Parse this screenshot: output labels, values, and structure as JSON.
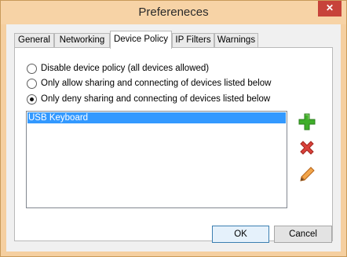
{
  "window": {
    "title": "Prefereneces",
    "close_label": "✕"
  },
  "tabs": [
    {
      "label": "General"
    },
    {
      "label": "Networking"
    },
    {
      "label": "Device Policy"
    },
    {
      "label": "IP Filters"
    },
    {
      "label": "Warnings"
    }
  ],
  "device_policy": {
    "options": [
      {
        "label": "Disable device policy (all devices allowed)",
        "selected": false
      },
      {
        "label": "Only allow sharing and connecting of devices listed below",
        "selected": false
      },
      {
        "label": "Only deny sharing and connecting of devices listed below",
        "selected": true
      }
    ],
    "devices": [
      {
        "name": "USB Keyboard",
        "selected": true
      }
    ],
    "actions": [
      "add-icon",
      "remove-icon",
      "edit-icon"
    ]
  },
  "footer": {
    "ok_label": "OK",
    "cancel_label": "Cancel"
  },
  "colors": {
    "accent": "#3399ff",
    "frame": "#f5cfa0",
    "close": "#c7433a",
    "add_green": "#3fae2a",
    "remove_red": "#d9413a",
    "edit_orange": "#e0872b"
  }
}
